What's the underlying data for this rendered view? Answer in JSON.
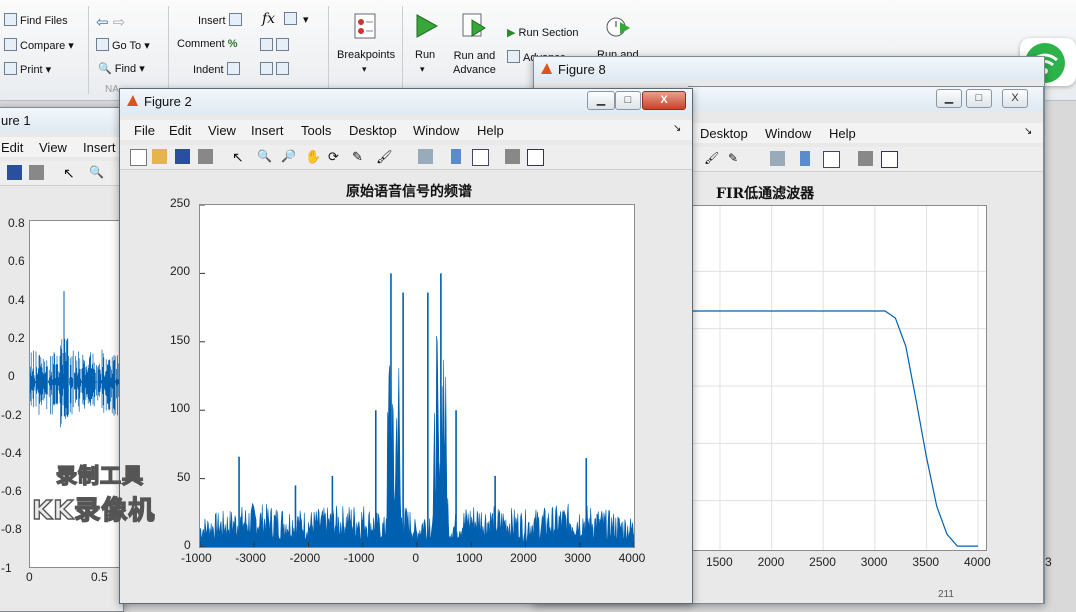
{
  "ribbon": {
    "find_files": "Find Files",
    "compare": "Compare",
    "print": "Print",
    "go_to": "Go To",
    "find": "Find",
    "nav_group": "NA",
    "insert": "Insert",
    "fx": "fx",
    "comment": "Comment",
    "indent": "Indent",
    "percent": "%",
    "breakpoints": "Breakpoints",
    "run": "Run",
    "run_and_advance_1": "Run and",
    "run_and_advance_2": "Advance",
    "run_section": "Run Section",
    "advance": "Advance",
    "run_and_time": "Run and"
  },
  "figure1": {
    "title": "ure 1",
    "menu": [
      "Edit",
      "View",
      "Insert"
    ],
    "yticks": [
      "0.8",
      "0.6",
      "0.4",
      "0.2",
      "0",
      "-0.2",
      "-0.4",
      "-0.6",
      "-0.8",
      "-1"
    ],
    "xticks": [
      "0",
      "0.5"
    ]
  },
  "figure2": {
    "title": "Figure 2",
    "menu": [
      "File",
      "Edit",
      "View",
      "Insert",
      "Tools",
      "Desktop",
      "Window",
      "Help"
    ],
    "plot_title": "原始语音信号的频谱",
    "minimize": "▁",
    "maximize": "□",
    "close": "X"
  },
  "figure8": {
    "title": "Figure 8",
    "menu": [
      "Desktop",
      "Window",
      "Help"
    ],
    "plot_title": "FIR低通滤波器",
    "xticks": [
      "1500",
      "2000",
      "2500",
      "3000",
      "3500",
      "4000"
    ],
    "side_tick": "3",
    "side_value": "211"
  },
  "watermark": {
    "line1": "录制工具",
    "line2": "KK录像机"
  },
  "colors": {
    "series": "#0060b0",
    "wifi": "#2db34a"
  },
  "chart_data": [
    {
      "type": "line",
      "title": "原始语音信号的频谱",
      "xlabel": "",
      "ylabel": "",
      "xlim": [
        -1000,
        4000
      ],
      "ylim": [
        0,
        250
      ],
      "xticks": [
        -1000,
        -3000,
        -2000,
        -1000,
        0,
        1000,
        2000,
        3000,
        4000
      ],
      "xtick_labels": [
        "-1000",
        "-3000",
        "-2000",
        "-1000",
        "0",
        "1000",
        "2000",
        "3000",
        "4000"
      ],
      "yticks": [
        0,
        50,
        100,
        150,
        200,
        250
      ],
      "grid": false,
      "series": [
        {
          "x": [
            -4000,
            -3000,
            -2000,
            -1000,
            -580,
            -540,
            -480,
            -420,
            -350,
            -300,
            -100,
            0,
            100,
            300,
            350,
            420,
            480,
            540,
            580,
            1000,
            2000,
            3000,
            4000
          ],
          "y": [
            20,
            30,
            25,
            30,
            20,
            100,
            200,
            45,
            185,
            30,
            25,
            15,
            25,
            30,
            185,
            45,
            200,
            100,
            20,
            30,
            25,
            30,
            20
          ]
        }
      ]
    },
    {
      "type": "line",
      "title": "FIR低通滤波器",
      "xlabel": "",
      "ylabel": "",
      "xlim": [
        1200,
        4000
      ],
      "ylim": [
        0,
        1.2
      ],
      "xticks": [
        1500,
        2000,
        2500,
        3000,
        3500,
        4000
      ],
      "grid": true,
      "series": [
        {
          "x": [
            1200,
            2000,
            2500,
            3000,
            3100,
            3200,
            3300,
            3400,
            3500,
            3600,
            3700,
            3800,
            3900,
            4000
          ],
          "y": [
            1.0,
            1.0,
            1.0,
            1.0,
            1.0,
            0.97,
            0.85,
            0.62,
            0.38,
            0.17,
            0.05,
            0.0,
            0.0,
            0.0
          ]
        }
      ]
    }
  ]
}
